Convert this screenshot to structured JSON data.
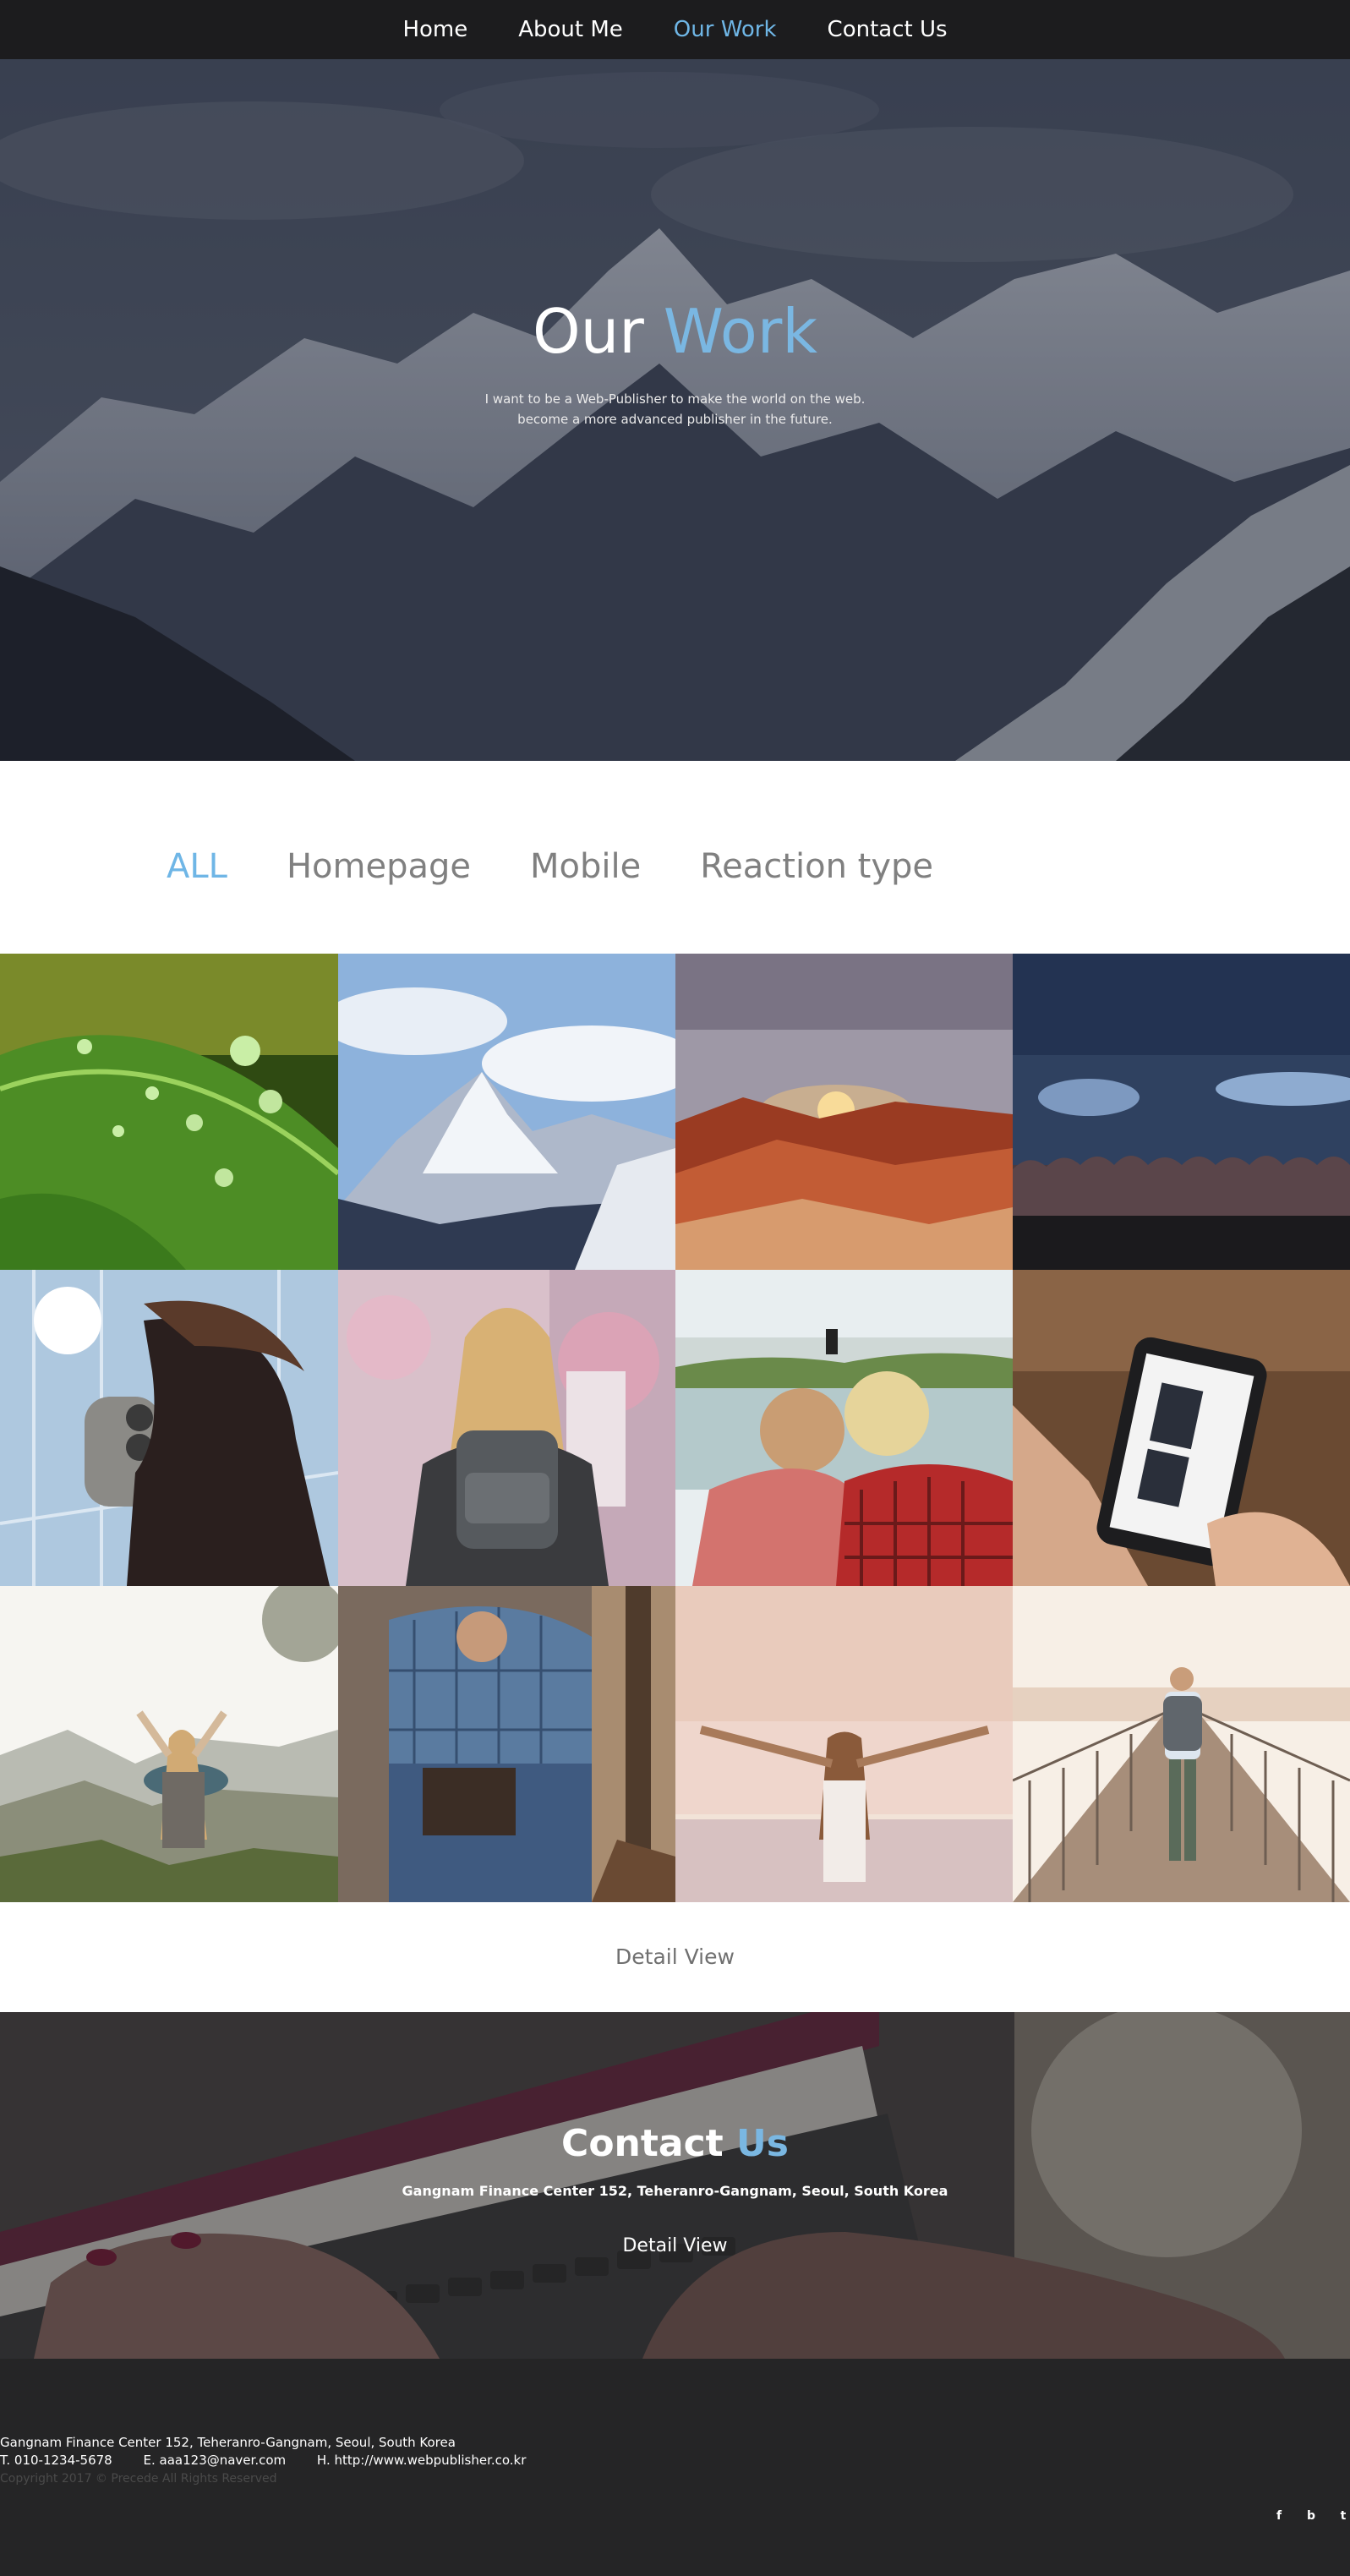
{
  "nav": {
    "items": [
      {
        "label": "Home",
        "active": false
      },
      {
        "label": "About Me",
        "active": false
      },
      {
        "label": "Our Work",
        "active": true
      },
      {
        "label": "Contact Us",
        "active": false
      }
    ]
  },
  "hero": {
    "title_main": "Our",
    "title_accent": "Work",
    "subtitle_line1": "I want to be a Web-Publisher to make the world on the web.",
    "subtitle_line2": "become a more advanced publisher in the future."
  },
  "filters": {
    "items": [
      {
        "label": "ALL",
        "active": true
      },
      {
        "label": "Homepage",
        "active": false
      },
      {
        "label": "Mobile",
        "active": false
      },
      {
        "label": "Reaction type",
        "active": false
      }
    ]
  },
  "gallery": {
    "items": [
      {
        "subject": "leaf with water drops"
      },
      {
        "subject": "snowy mountain peak"
      },
      {
        "subject": "red rock canyon at sunrise"
      },
      {
        "subject": "night sky over treeline"
      },
      {
        "subject": "woman at observation binoculars"
      },
      {
        "subject": "woman with backpack under blossoms"
      },
      {
        "subject": "couple taking selfie by lake"
      },
      {
        "subject": "hand holding smartphone"
      },
      {
        "subject": "woman with raised arms on cliff"
      },
      {
        "subject": "man sitting with book"
      },
      {
        "subject": "woman with arms spread at sea"
      },
      {
        "subject": "man walking on pier"
      }
    ]
  },
  "detail_view_label": "Detail View",
  "contact": {
    "title_main": "Contact",
    "title_accent": "Us",
    "address": "Gangnam Finance Center 152, Teheranro-Gangnam, Seoul, South Korea",
    "detail_label": "Detail View"
  },
  "footer": {
    "address": "Gangnam Finance Center 152, Teheranro-Gangnam, Seoul, South Korea",
    "phone": "T. 010-1234-5678",
    "email": "E. aaa123@naver.com",
    "homepage": "H. http://www.webpublisher.co.kr",
    "copyright": "Copyright 2017 © Precede All Rights Reserved",
    "social": [
      "f",
      "b",
      "t"
    ]
  },
  "colors": {
    "accent": "#6fb6e6",
    "nav_bg": "#1c1c1e",
    "footer_bg": "#252526"
  }
}
